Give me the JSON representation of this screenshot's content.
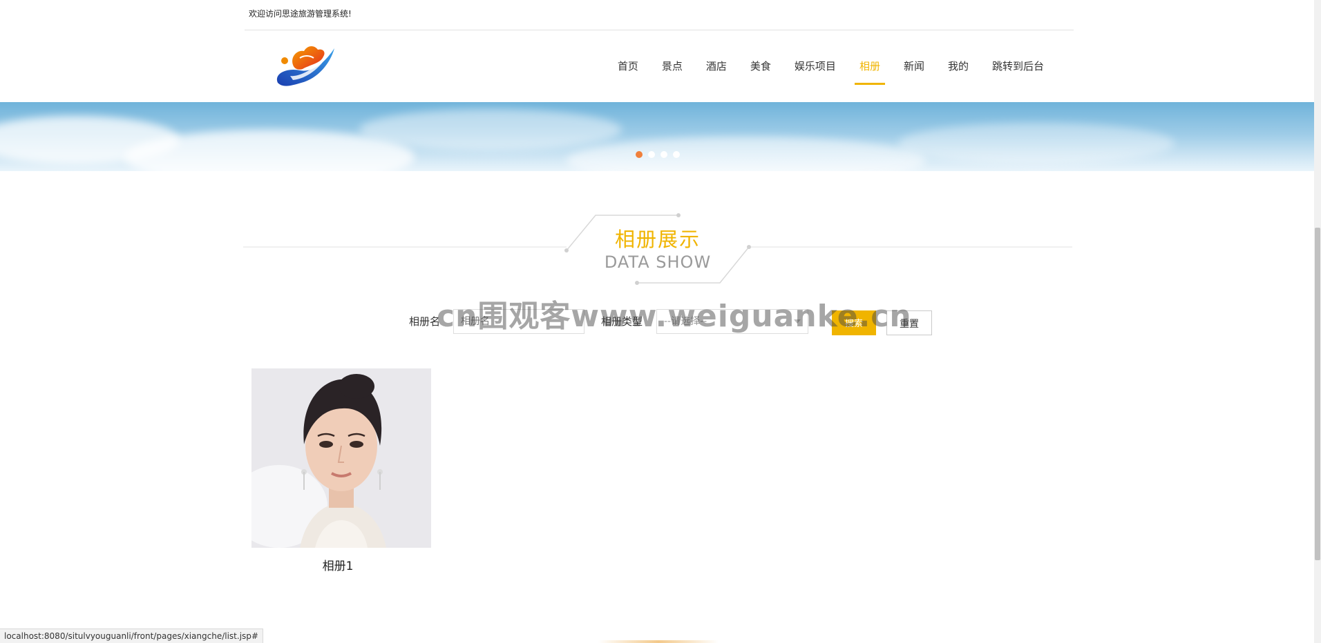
{
  "welcome": {
    "text": "欢迎访问思途旅游管理系统!"
  },
  "logo": {
    "icon": "dragon-logo-icon"
  },
  "nav": {
    "items": [
      {
        "label": "首页",
        "active": false
      },
      {
        "label": "景点",
        "active": false
      },
      {
        "label": "酒店",
        "active": false
      },
      {
        "label": "美食",
        "active": false
      },
      {
        "label": "娱乐项目",
        "active": false
      },
      {
        "label": "相册",
        "active": true
      },
      {
        "label": "新闻",
        "active": false
      },
      {
        "label": "我的",
        "active": false
      },
      {
        "label": "跳转到后台",
        "active": false
      }
    ]
  },
  "banner": {
    "slide_count": 4,
    "active_index": 0
  },
  "section": {
    "title_cn": "相册展示",
    "title_en": "DATA SHOW"
  },
  "search": {
    "name_label": "相册名",
    "name_placeholder": "相册名",
    "type_label": "相册类型",
    "type_selected": "--请选择--",
    "search_button": "搜索",
    "reset_button": "重置"
  },
  "albums": [
    {
      "title": "相册1"
    }
  ],
  "watermark": {
    "text": "cn围观客www.weiguanke.cn"
  },
  "statusbar": {
    "url": "localhost:8080/situlvyouguanli/front/pages/xiangche/list.jsp#"
  },
  "colors": {
    "accent": "#f0b400",
    "dot_active": "#f0803c"
  }
}
